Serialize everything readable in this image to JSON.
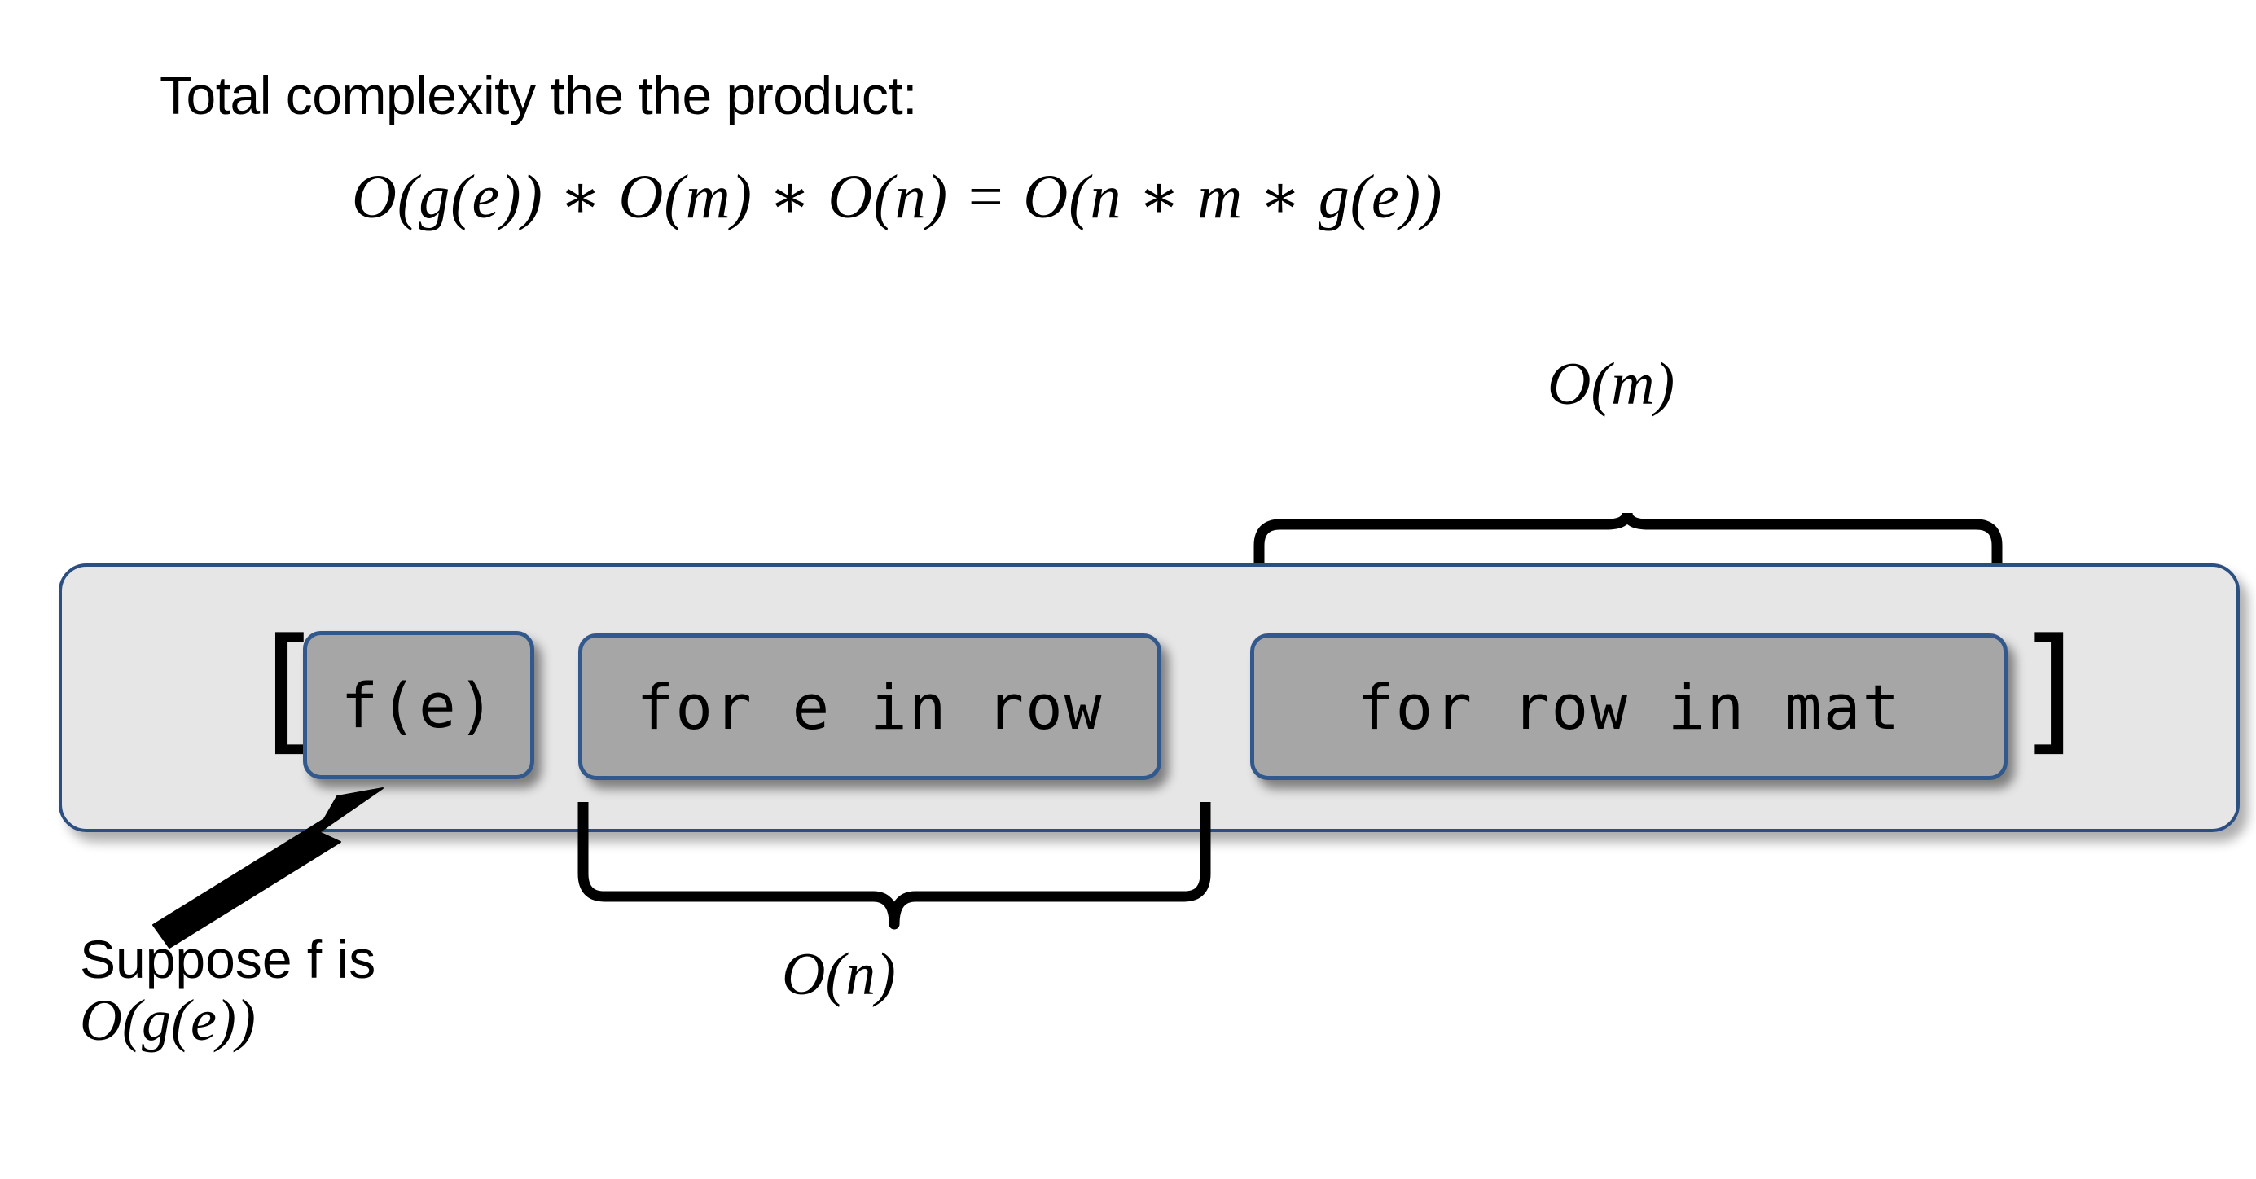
{
  "slide": {
    "heading": "Total complexity the the product:",
    "total_formula": "O(g(e)) ∗ O(m) ∗ O(n) = O(n ∗ m ∗ g(e))"
  },
  "code_expression": {
    "bracket_open": "[",
    "bracket_close": "]",
    "boxes": [
      {
        "name": "call",
        "text": "f(e)"
      },
      {
        "name": "inner-loop",
        "text": "for e in row"
      },
      {
        "name": "outer-loop",
        "text": "for row in mat"
      }
    ]
  },
  "annotations": {
    "brace_outer_label": "O(m)",
    "brace_inner_label": "O(n)",
    "caption_line1": "Suppose f is",
    "caption_line2": "O(g(e))"
  },
  "colors": {
    "page_background": "#ffffff",
    "container_fill": "#e6e6e6",
    "container_border": "#2b4f81",
    "chip_fill": "#a6a6a6",
    "chip_border": "#31598e",
    "ink": "#000000"
  }
}
